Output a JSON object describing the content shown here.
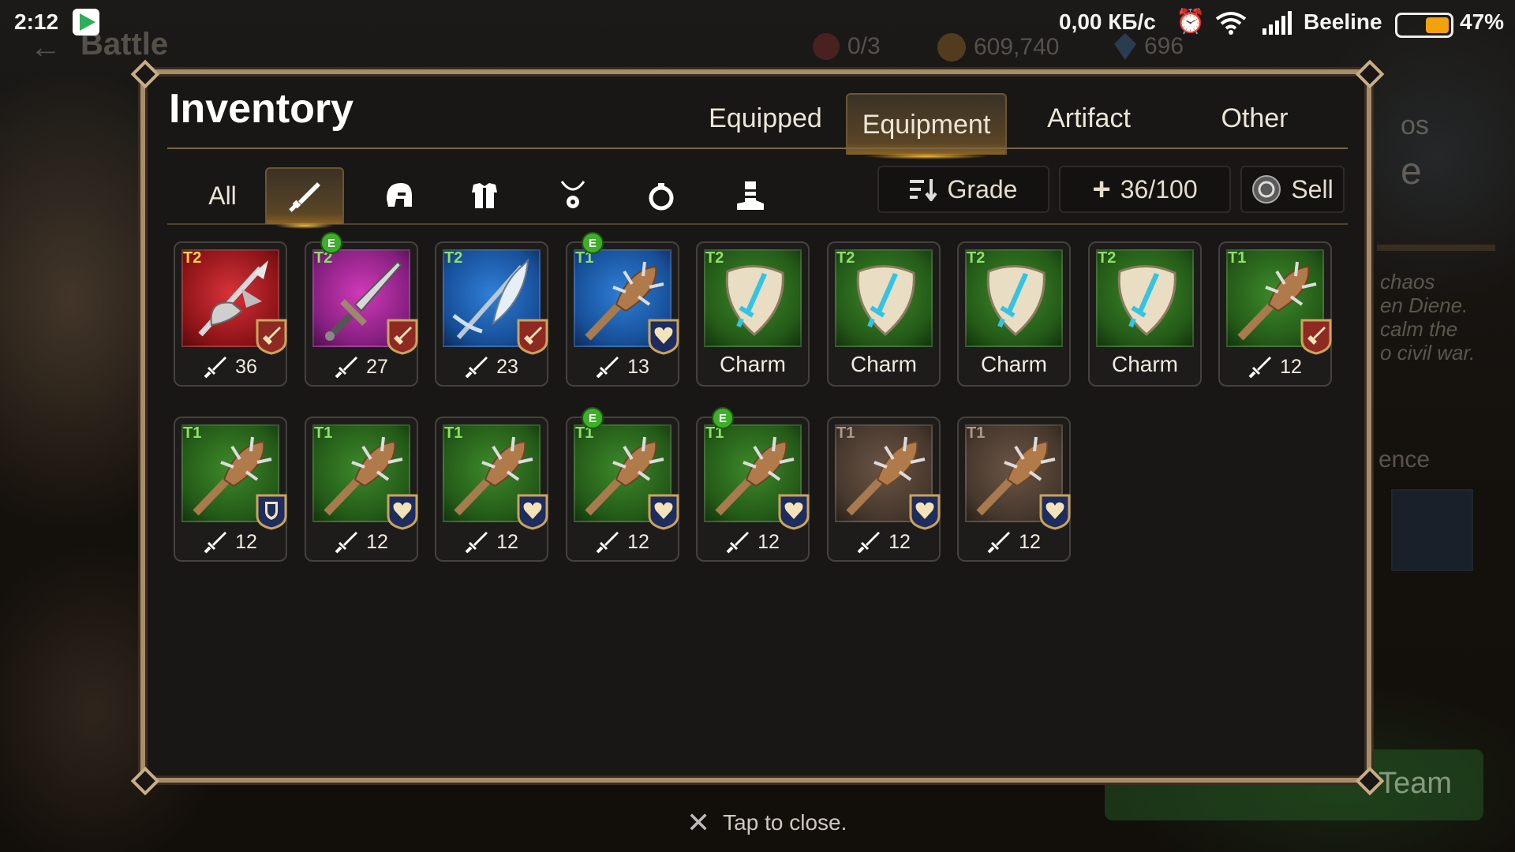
{
  "status_bar": {
    "time": "2:12",
    "net_speed": "0,00 КБ/с",
    "carrier": "Beeline",
    "battery": "47%",
    "battery_level": 0.47
  },
  "background": {
    "back_label": "Battle",
    "kill_count": "0/3",
    "gold": "609,740",
    "gems": "696",
    "lore_lines": [
      "chaos",
      "en Diene.",
      "calm the",
      "o civil war."
    ],
    "partial_title_1": "os",
    "partial_title_2": "e",
    "section_label": "ence",
    "team_button": "Team"
  },
  "inventory": {
    "title": "Inventory",
    "tabs": [
      {
        "label": "Equipped",
        "active": false
      },
      {
        "label": "Equipment",
        "active": true
      },
      {
        "label": "Artifact",
        "active": false
      },
      {
        "label": "Other",
        "active": false
      }
    ],
    "filters": [
      {
        "label": "All",
        "icon": "text",
        "active": false
      },
      {
        "label": "",
        "icon": "sword-icon",
        "active": true
      },
      {
        "label": "",
        "icon": "helmet-icon",
        "active": false
      },
      {
        "label": "",
        "icon": "armor-icon",
        "active": false
      },
      {
        "label": "",
        "icon": "necklace-icon",
        "active": false
      },
      {
        "label": "",
        "icon": "ring-icon",
        "active": false
      },
      {
        "label": "",
        "icon": "boots-icon",
        "active": false
      }
    ],
    "sort_label": "Grade",
    "capacity_label": "36/100",
    "sell_label": "Sell",
    "close_hint": "Tap to close.",
    "items": [
      {
        "tier": "T2",
        "grade": "red",
        "weapon": "axe",
        "badge": "attack-badge",
        "equipped": false,
        "value": "36"
      },
      {
        "tier": "T2",
        "grade": "purple",
        "weapon": "sword",
        "badge": "attack-badge",
        "equipped": true,
        "value": "27"
      },
      {
        "tier": "T2",
        "grade": "blue",
        "weapon": "scythe",
        "badge": "attack-badge",
        "equipped": false,
        "value": "23"
      },
      {
        "tier": "T1",
        "grade": "blue",
        "weapon": "club",
        "badge": "heart-badge",
        "equipped": true,
        "value": "13"
      },
      {
        "tier": "T2",
        "grade": "green",
        "weapon": "charm",
        "badge": "",
        "equipped": false,
        "value": "Charm"
      },
      {
        "tier": "T2",
        "grade": "green",
        "weapon": "charm",
        "badge": "",
        "equipped": false,
        "value": "Charm"
      },
      {
        "tier": "T2",
        "grade": "green",
        "weapon": "charm",
        "badge": "",
        "equipped": false,
        "value": "Charm"
      },
      {
        "tier": "T2",
        "grade": "green",
        "weapon": "charm",
        "badge": "",
        "equipped": false,
        "value": "Charm"
      },
      {
        "tier": "T1",
        "grade": "green",
        "weapon": "club",
        "badge": "attack-badge",
        "equipped": false,
        "value": "12"
      },
      {
        "tier": "T1",
        "grade": "green",
        "weapon": "club",
        "badge": "shield-badge",
        "equipped": false,
        "value": "12"
      },
      {
        "tier": "T1",
        "grade": "green",
        "weapon": "club",
        "badge": "heart-badge",
        "equipped": false,
        "value": "12"
      },
      {
        "tier": "T1",
        "grade": "green",
        "weapon": "club",
        "badge": "heart-badge",
        "equipped": false,
        "value": "12"
      },
      {
        "tier": "T1",
        "grade": "green",
        "weapon": "club",
        "badge": "heart-badge",
        "equipped": true,
        "value": "12"
      },
      {
        "tier": "T1",
        "grade": "green",
        "weapon": "club",
        "badge": "heart-badge",
        "equipped": true,
        "value": "12"
      },
      {
        "tier": "T1",
        "grade": "brown",
        "weapon": "club",
        "badge": "heart-badge",
        "equipped": false,
        "value": "12"
      },
      {
        "tier": "T1",
        "grade": "brown",
        "weapon": "club",
        "badge": "heart-badge",
        "equipped": false,
        "value": "12"
      }
    ]
  },
  "colors": {
    "accent_gold": "#c99a45",
    "frame": "#a88d6a",
    "attack_badge": "#8e2a22",
    "heart_badge": "#1e2c5e",
    "equip_green": "#3fae2a"
  }
}
